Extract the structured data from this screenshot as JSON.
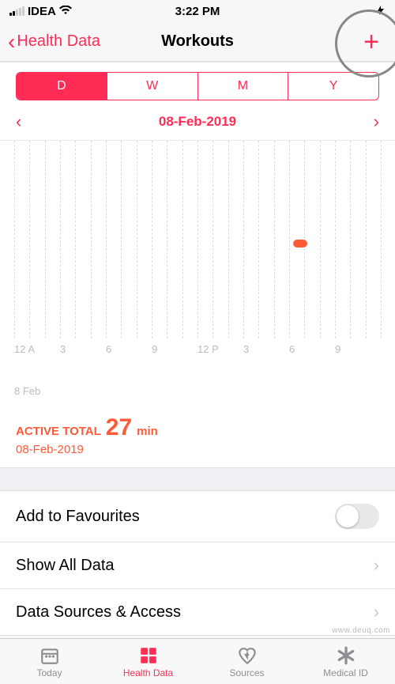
{
  "status": {
    "carrier": "IDEA",
    "time": "3:22 PM"
  },
  "nav": {
    "back_label": "Health Data",
    "title": "Workouts"
  },
  "segments": {
    "d": "D",
    "w": "W",
    "m": "M",
    "y": "Y"
  },
  "date_nav": {
    "date": "08-Feb-2019"
  },
  "chart_data": {
    "type": "bar",
    "categories": [
      "12 A",
      "3",
      "6",
      "9",
      "12 P",
      "3",
      "6",
      "9"
    ],
    "values": [
      0,
      0,
      0,
      0,
      0,
      0,
      27,
      0
    ],
    "title": "",
    "xlabel": "8 Feb",
    "ylabel": "",
    "ylim": [
      0,
      60
    ]
  },
  "chart_labels": {
    "l0": "12 A",
    "l1": "3",
    "l2": "6",
    "l3": "9",
    "l4": "12 P",
    "l5": "3",
    "l6": "6",
    "l7": "9",
    "sub": "8 Feb"
  },
  "summary": {
    "label": "ACTIVE TOTAL",
    "value": "27",
    "unit": "min",
    "date": "08-Feb-2019"
  },
  "rows": {
    "fav": "Add to Favourites",
    "all": "Show All Data",
    "src": "Data Sources & Access"
  },
  "tabs": {
    "today": "Today",
    "health": "Health Data",
    "sources": "Sources",
    "medical": "Medical ID"
  },
  "watermark": "www.deuq.com"
}
